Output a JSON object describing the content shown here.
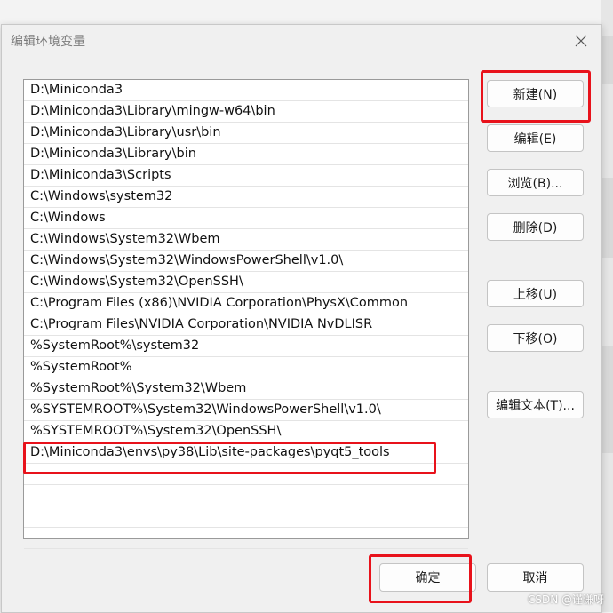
{
  "dialog": {
    "title": "编辑环境变量"
  },
  "path_entries": [
    "D:\\Miniconda3",
    "D:\\Miniconda3\\Library\\mingw-w64\\bin",
    "D:\\Miniconda3\\Library\\usr\\bin",
    "D:\\Miniconda3\\Library\\bin",
    "D:\\Miniconda3\\Scripts",
    "C:\\Windows\\system32",
    "C:\\Windows",
    "C:\\Windows\\System32\\Wbem",
    "C:\\Windows\\System32\\WindowsPowerShell\\v1.0\\",
    "C:\\Windows\\System32\\OpenSSH\\",
    "C:\\Program Files (x86)\\NVIDIA Corporation\\PhysX\\Common",
    "C:\\Program Files\\NVIDIA Corporation\\NVIDIA NvDLISR",
    "%SystemRoot%\\system32",
    "%SystemRoot%",
    "%SystemRoot%\\System32\\Wbem",
    "%SYSTEMROOT%\\System32\\WindowsPowerShell\\v1.0\\",
    "%SYSTEMROOT%\\System32\\OpenSSH\\",
    "D:\\Miniconda3\\envs\\py38\\Lib\\site-packages\\pyqt5_tools",
    "",
    "",
    "",
    ""
  ],
  "buttons": {
    "new": "新建(N)",
    "edit": "编辑(E)",
    "browse": "浏览(B)...",
    "delete": "删除(D)",
    "move_up": "上移(U)",
    "move_down": "下移(O)",
    "edit_text": "编辑文本(T)...",
    "ok": "确定",
    "cancel": "取消"
  },
  "watermark": "CSDN @谨谦呀",
  "colors": {
    "highlight": "#e8121b",
    "dialog_bg": "#f0f0f0",
    "list_bg": "#ffffff"
  }
}
